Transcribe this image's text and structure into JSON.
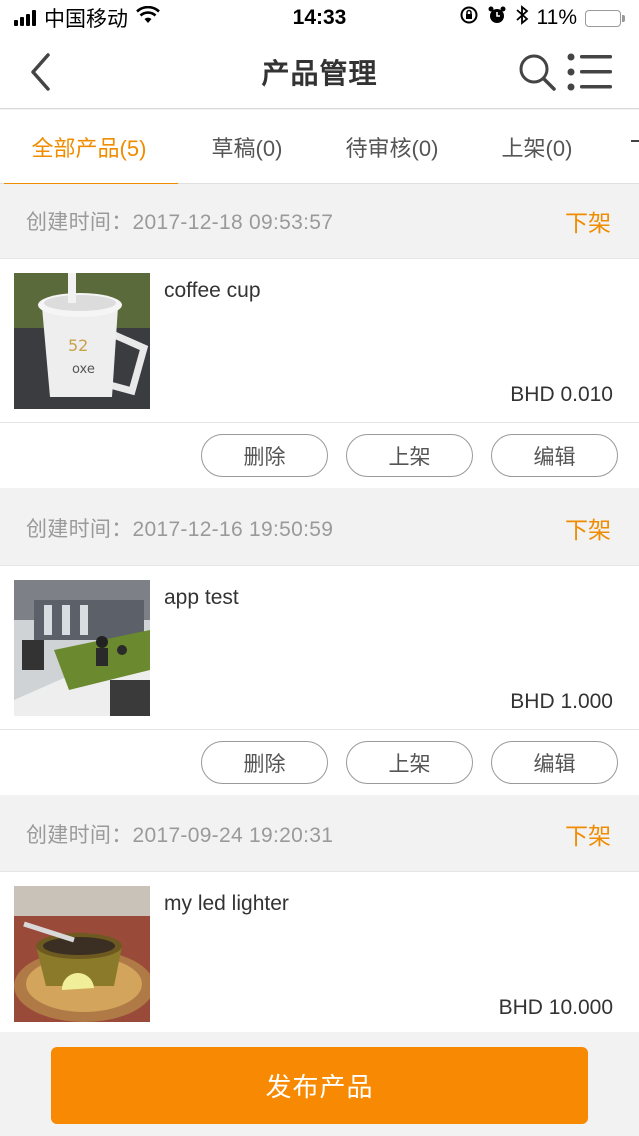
{
  "status_bar": {
    "carrier": "中国移动",
    "time": "14:33",
    "battery": "11%",
    "battery_level": 0.11,
    "icons": [
      "signal-icon",
      "wifi-icon",
      "rotation-lock-icon",
      "alarm-icon",
      "bluetooth-icon",
      "battery-icon"
    ]
  },
  "nav": {
    "title": "产品管理",
    "icons": [
      "back-icon",
      "search-icon",
      "menu-list-icon"
    ]
  },
  "tabs": [
    {
      "label": "全部产品(5)",
      "active": true
    },
    {
      "label": "草稿(0)",
      "active": false
    },
    {
      "label": "待审核(0)",
      "active": false
    },
    {
      "label": "上架(0)",
      "active": false
    }
  ],
  "products": [
    {
      "created_label": "创建时间：",
      "created_at": "2017-12-18 09:53:57",
      "status_action": "下架",
      "name": "coffee cup",
      "price": "BHD 0.010",
      "image": "coffee-cup-photo",
      "actions": [
        "删除",
        "上架",
        "编辑"
      ]
    },
    {
      "created_label": "创建时间：",
      "created_at": "2017-12-16 19:50:59",
      "status_action": "下架",
      "name": "app test",
      "price": "BHD 1.000",
      "image": "office-photo",
      "actions": [
        "删除",
        "上架",
        "编辑"
      ]
    },
    {
      "created_label": "创建时间：",
      "created_at": "2017-09-24 19:20:31",
      "status_action": "下架",
      "name": "my led lighter",
      "price": "BHD 10.000",
      "image": "dessert-photo",
      "actions": []
    }
  ],
  "publish_button": "发布产品",
  "colors": {
    "accent": "#f08c00",
    "primary_button": "#f78a02",
    "background": "#f2f2f2",
    "muted_text": "#9a9a9a"
  }
}
